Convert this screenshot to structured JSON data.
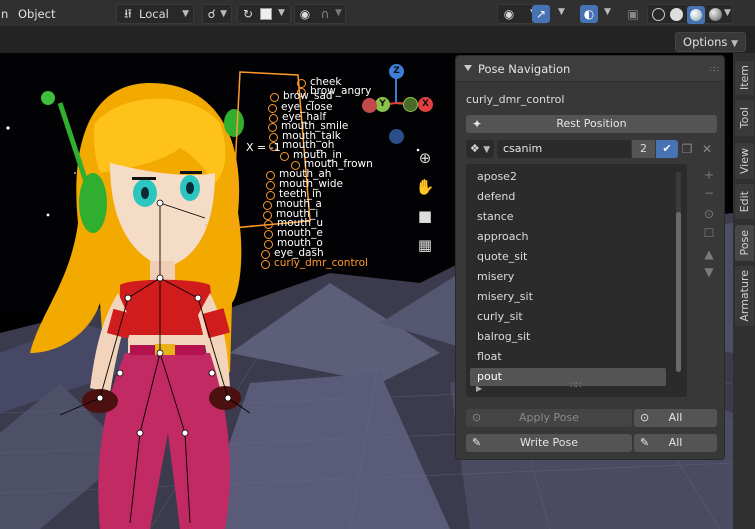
{
  "header": {
    "menu_object": "Object",
    "orientation": "Local",
    "options_label": "Options"
  },
  "viewport": {
    "bone_labels": [
      "cheek",
      "brow_angry",
      "brow_sad",
      "eye_close",
      "eye_half",
      "mouth_smile",
      "mouth_talk",
      "mouth_oh",
      "mouth_in",
      "mouth_frown",
      "mouth_ah",
      "mouth_wide",
      "teeth_in",
      "mouth_a",
      "mouth_i",
      "mouth_u",
      "mouth_e",
      "mouth_o",
      "eye_dash",
      "curly_dmr_control"
    ],
    "x_mirror_label": "X = -1",
    "gizmo": {
      "z": "Z",
      "y": "Y",
      "x": "X"
    }
  },
  "panel": {
    "title": "Pose Navigation",
    "armature_name": "curly_dmr_control",
    "rest_position_label": "Rest Position",
    "library_name": "csanim",
    "library_users": "2",
    "poses": [
      "apose2",
      "defend",
      "stance",
      "approach",
      "quote_sit",
      "misery",
      "misery_sit",
      "curly_sit",
      "balrog_sit",
      "float",
      "pout"
    ],
    "active_pose": "pout",
    "apply_pose_label": "Apply Pose",
    "apply_all_label": "All",
    "write_pose_label": "Write Pose",
    "write_all_label": "All"
  },
  "tabs": [
    "Item",
    "Tool",
    "View",
    "Edit",
    "Pose",
    "Armature"
  ],
  "active_tab": "Pose",
  "colors": {
    "accent_blue": "#4772b3",
    "header_bg": "#303030",
    "panel_bg": "#383838",
    "bone_orange": "#ff9a2e"
  }
}
